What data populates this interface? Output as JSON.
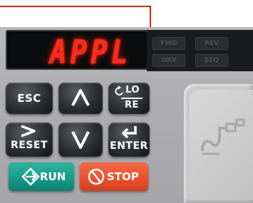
{
  "display": {
    "text": "APPL"
  },
  "status_leds": [
    {
      "id": "led-1",
      "label": "FWD"
    },
    {
      "id": "led-2",
      "label": "REV"
    },
    {
      "id": "led-3",
      "label": "DRV"
    },
    {
      "id": "led-4",
      "label": "SEQ"
    }
  ],
  "keys": {
    "esc": "ESC",
    "lo_re_top": "LO",
    "lo_re_bottom": "RE",
    "reset": "RESET",
    "enter": "ENTER",
    "run": "RUN",
    "stop": "STOP"
  },
  "colors": {
    "callout": "#d8261f",
    "display_text": "#ff2a1a",
    "run": "#179a86",
    "stop": "#e9502b"
  }
}
